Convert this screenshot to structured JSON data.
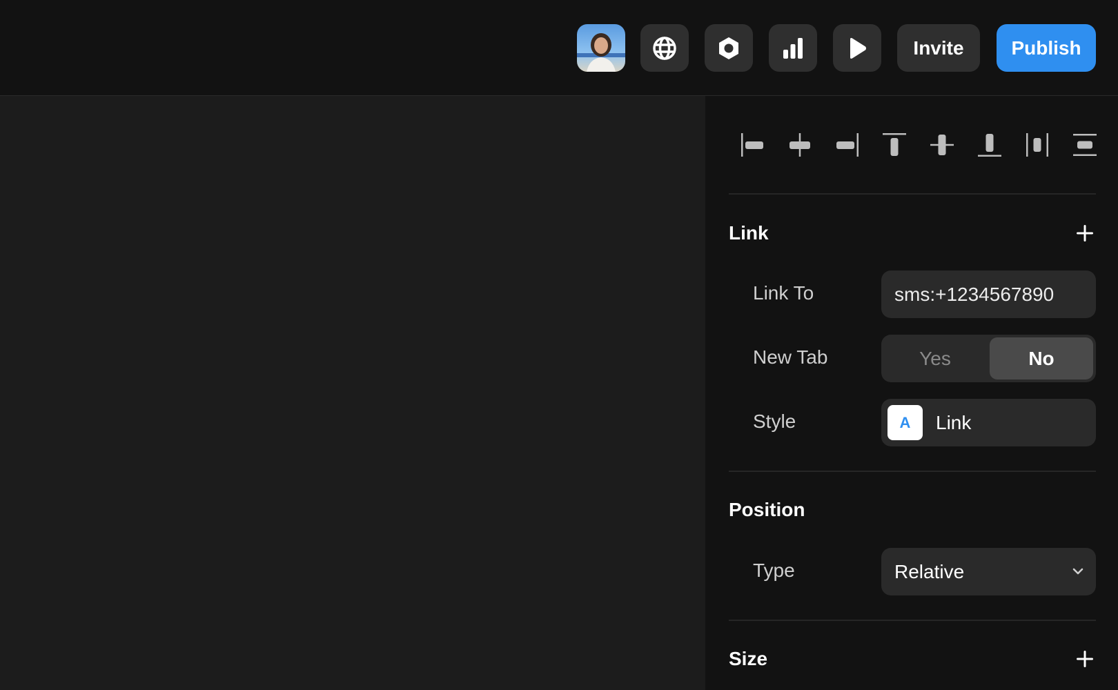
{
  "toolbar": {
    "invite_label": "Invite",
    "publish_label": "Publish",
    "icons": [
      "globe-icon",
      "settings-hex-icon",
      "analytics-icon",
      "play-icon"
    ],
    "publish_color": "#2f8ff0"
  },
  "alignment": {
    "icons": [
      "align-left-icon",
      "align-center-horizontal-icon",
      "align-right-icon",
      "align-top-icon",
      "align-center-vertical-icon",
      "align-bottom-icon",
      "distribute-horizontal-icon",
      "distribute-vertical-icon"
    ]
  },
  "link_section": {
    "title": "Link",
    "link_to": {
      "label": "Link To",
      "value": "sms:+1234567890"
    },
    "new_tab": {
      "label": "New Tab",
      "options": [
        "Yes",
        "No"
      ],
      "selected": "No"
    },
    "style": {
      "label": "Style",
      "chip_letter": "A",
      "value": "Link"
    }
  },
  "position_section": {
    "title": "Position",
    "type": {
      "label": "Type",
      "value": "Relative"
    }
  },
  "size_section": {
    "title": "Size"
  }
}
